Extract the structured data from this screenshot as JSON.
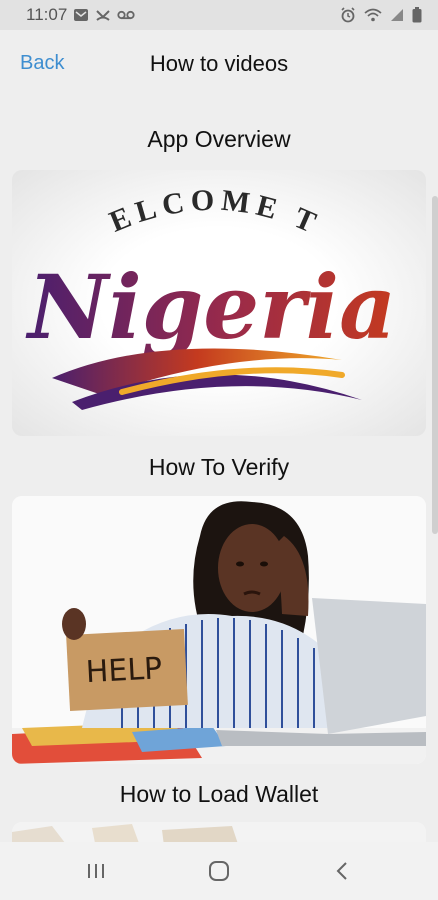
{
  "status_bar": {
    "time": "11:07",
    "left_icons": [
      "message-icon",
      "missed-call-icon",
      "voicemail-icon"
    ],
    "right_icons": [
      "alarm-icon",
      "wifi-icon",
      "signal-icon",
      "battery-icon"
    ]
  },
  "header": {
    "back_label": "Back",
    "title": "How to videos"
  },
  "videos": [
    {
      "title": "App Overview",
      "thumb_line1": "WELCOME TO",
      "thumb_line2": "Nigeria"
    },
    {
      "title": "How To Verify",
      "sign_text": "HELP"
    },
    {
      "title": "How to Load Wallet"
    }
  ],
  "nav_bar": {
    "icons": [
      "recent-apps-icon",
      "home-icon",
      "back-icon"
    ]
  },
  "colors": {
    "accent": "#3e8ed0",
    "background": "#eeeeee",
    "logo_purple": "#4a1f6e",
    "logo_red": "#c43a1f",
    "logo_orange": "#f0a92a"
  }
}
